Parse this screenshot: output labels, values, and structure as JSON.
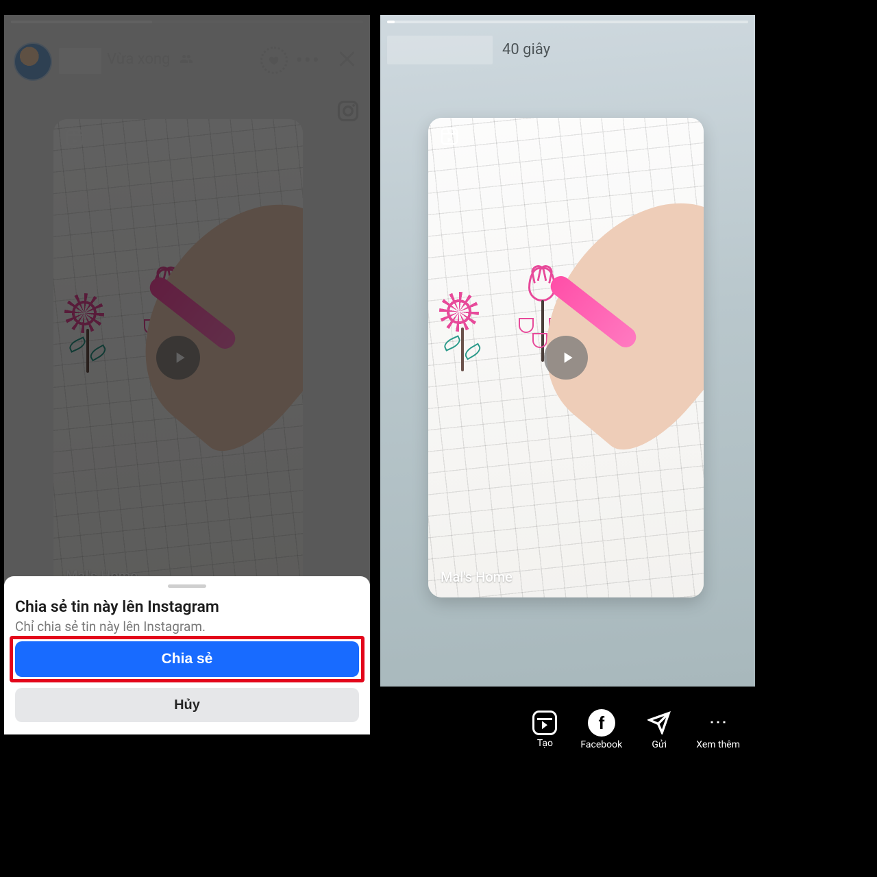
{
  "left": {
    "time_label": "Vừa xong",
    "card_credit": "Mal's Home",
    "sheet": {
      "title": "Chia sẻ tin này lên Instagram",
      "subtitle": "Chỉ chia sẻ tin này lên Instagram.",
      "primary": "Chia sẻ",
      "secondary": "Hủy"
    }
  },
  "right": {
    "time_label": "40 giây",
    "card_credit": "Mal's Home",
    "actions": {
      "create": "Tạo",
      "facebook": "Facebook",
      "send": "Gửi",
      "more": "Xem thêm"
    }
  }
}
